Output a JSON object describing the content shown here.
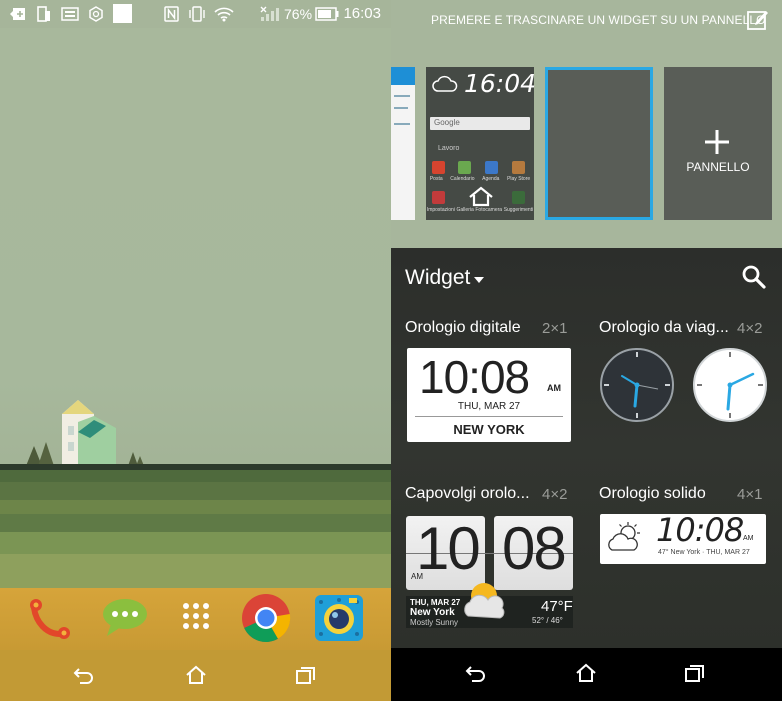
{
  "status_bar": {
    "battery_percent": "76%",
    "time": "16:03",
    "icons": [
      "plus-box-icon",
      "phone-tablet-icon",
      "keyboard-icon",
      "settings-hex-icon",
      "white-square-icon",
      "nfc-icon",
      "vibrate-icon",
      "wifi-icon",
      "signal-icon",
      "battery-icon"
    ]
  },
  "home": {
    "dock_apps": [
      "phone-app-icon",
      "messages-app-icon",
      "app-drawer-icon",
      "chrome-app-icon",
      "camera-app-icon"
    ],
    "nav": [
      "back-icon",
      "home-icon",
      "recents-icon"
    ]
  },
  "picker": {
    "hint": "PREMERE E TRASCINARE UN WIDGET SU UN PANNELLO",
    "add_panel_label": "PANNELLO",
    "mini_clock_time": "16:04",
    "mini_search_label": "Google",
    "mini_folder_label": "Lavoro",
    "mini_apps": [
      "Posta",
      "Calendario",
      "Agenda",
      "Play Store",
      "Impostazioni",
      "Galleria",
      "Fotocamera",
      "Suggerimenti"
    ],
    "section_title": "Widget",
    "widgets": [
      {
        "name": "Orologio digitale",
        "size": "2×1"
      },
      {
        "name": "Orologio da viag...",
        "size": "4×2"
      },
      {
        "name": "Capovolgi orolo...",
        "size": "4×2"
      },
      {
        "name": "Orologio solido",
        "size": "4×1"
      }
    ],
    "digital_clock": {
      "time": "10:08",
      "ampm": "AM",
      "date": "THU, MAR 27",
      "city": "NEW YORK"
    },
    "flip_clock": {
      "hour": "10",
      "minute": "08",
      "ampm": "AM",
      "date": "THU, MAR 27",
      "city": "New York",
      "condition": "Mostly Sunny",
      "temp": "47°F",
      "range": "52° / 46°"
    },
    "solid_clock": {
      "time": "10:08",
      "ampm": "AM",
      "info": "47° New York · THU, MAR 27"
    }
  },
  "colors": {
    "accent": "#2aa8e3",
    "home_bg": "#a8b89c",
    "dock": "#c89a34"
  }
}
